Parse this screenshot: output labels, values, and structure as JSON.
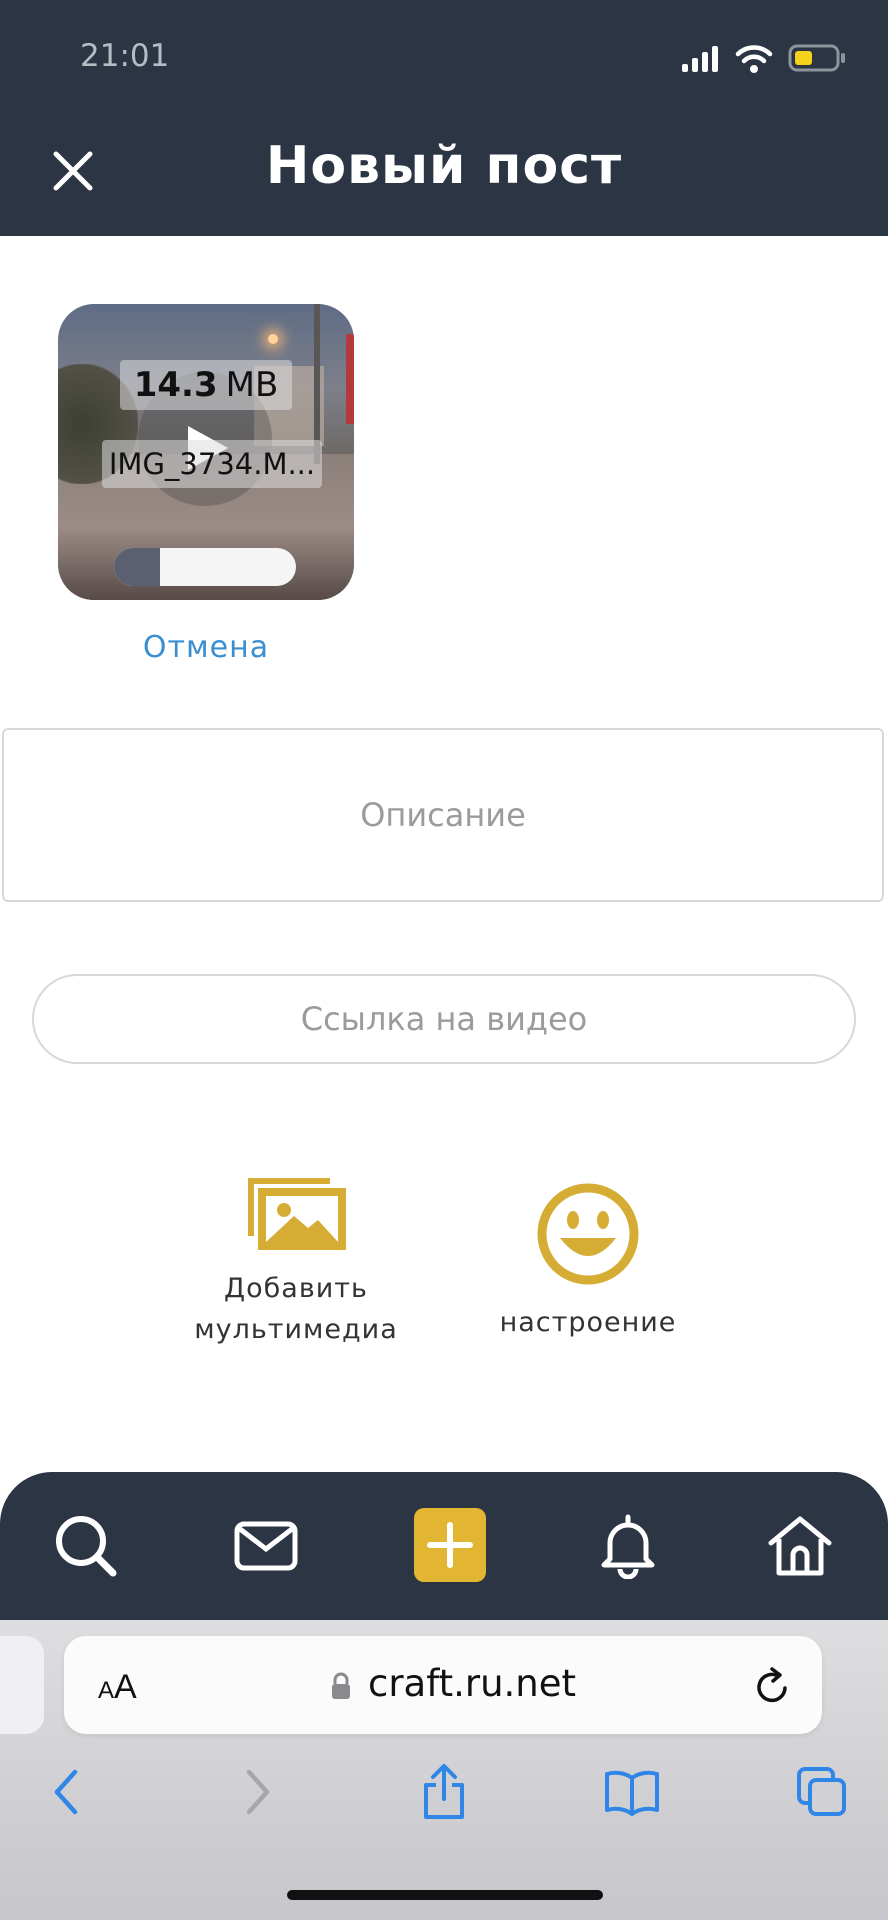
{
  "status_bar": {
    "time": "21:01"
  },
  "header": {
    "title": "Новый пост"
  },
  "media": {
    "size_value": "14.3",
    "size_unit": "MB",
    "filename": "IMG_3734.M...",
    "upload_progress": 0.25,
    "cancel_label": "Отмена"
  },
  "form": {
    "description_placeholder": "Описание",
    "video_link_placeholder": "Ссылка на видео"
  },
  "actions": {
    "add_media_line1": "Добавить",
    "add_media_line2": "мультимедиа",
    "mood_label": "настроение"
  },
  "bottom_nav": {
    "items": [
      "search-icon",
      "mail-icon",
      "plus-icon",
      "bell-icon",
      "home-icon"
    ]
  },
  "browser": {
    "text_size_label_small": "A",
    "text_size_label_large": "A",
    "url": "craft.ru.net"
  },
  "colors": {
    "header_bg": "#2b3543",
    "accent_gold": "#e2b632",
    "link_blue": "#3b8fd1",
    "safari_blue": "#2f86e6"
  }
}
